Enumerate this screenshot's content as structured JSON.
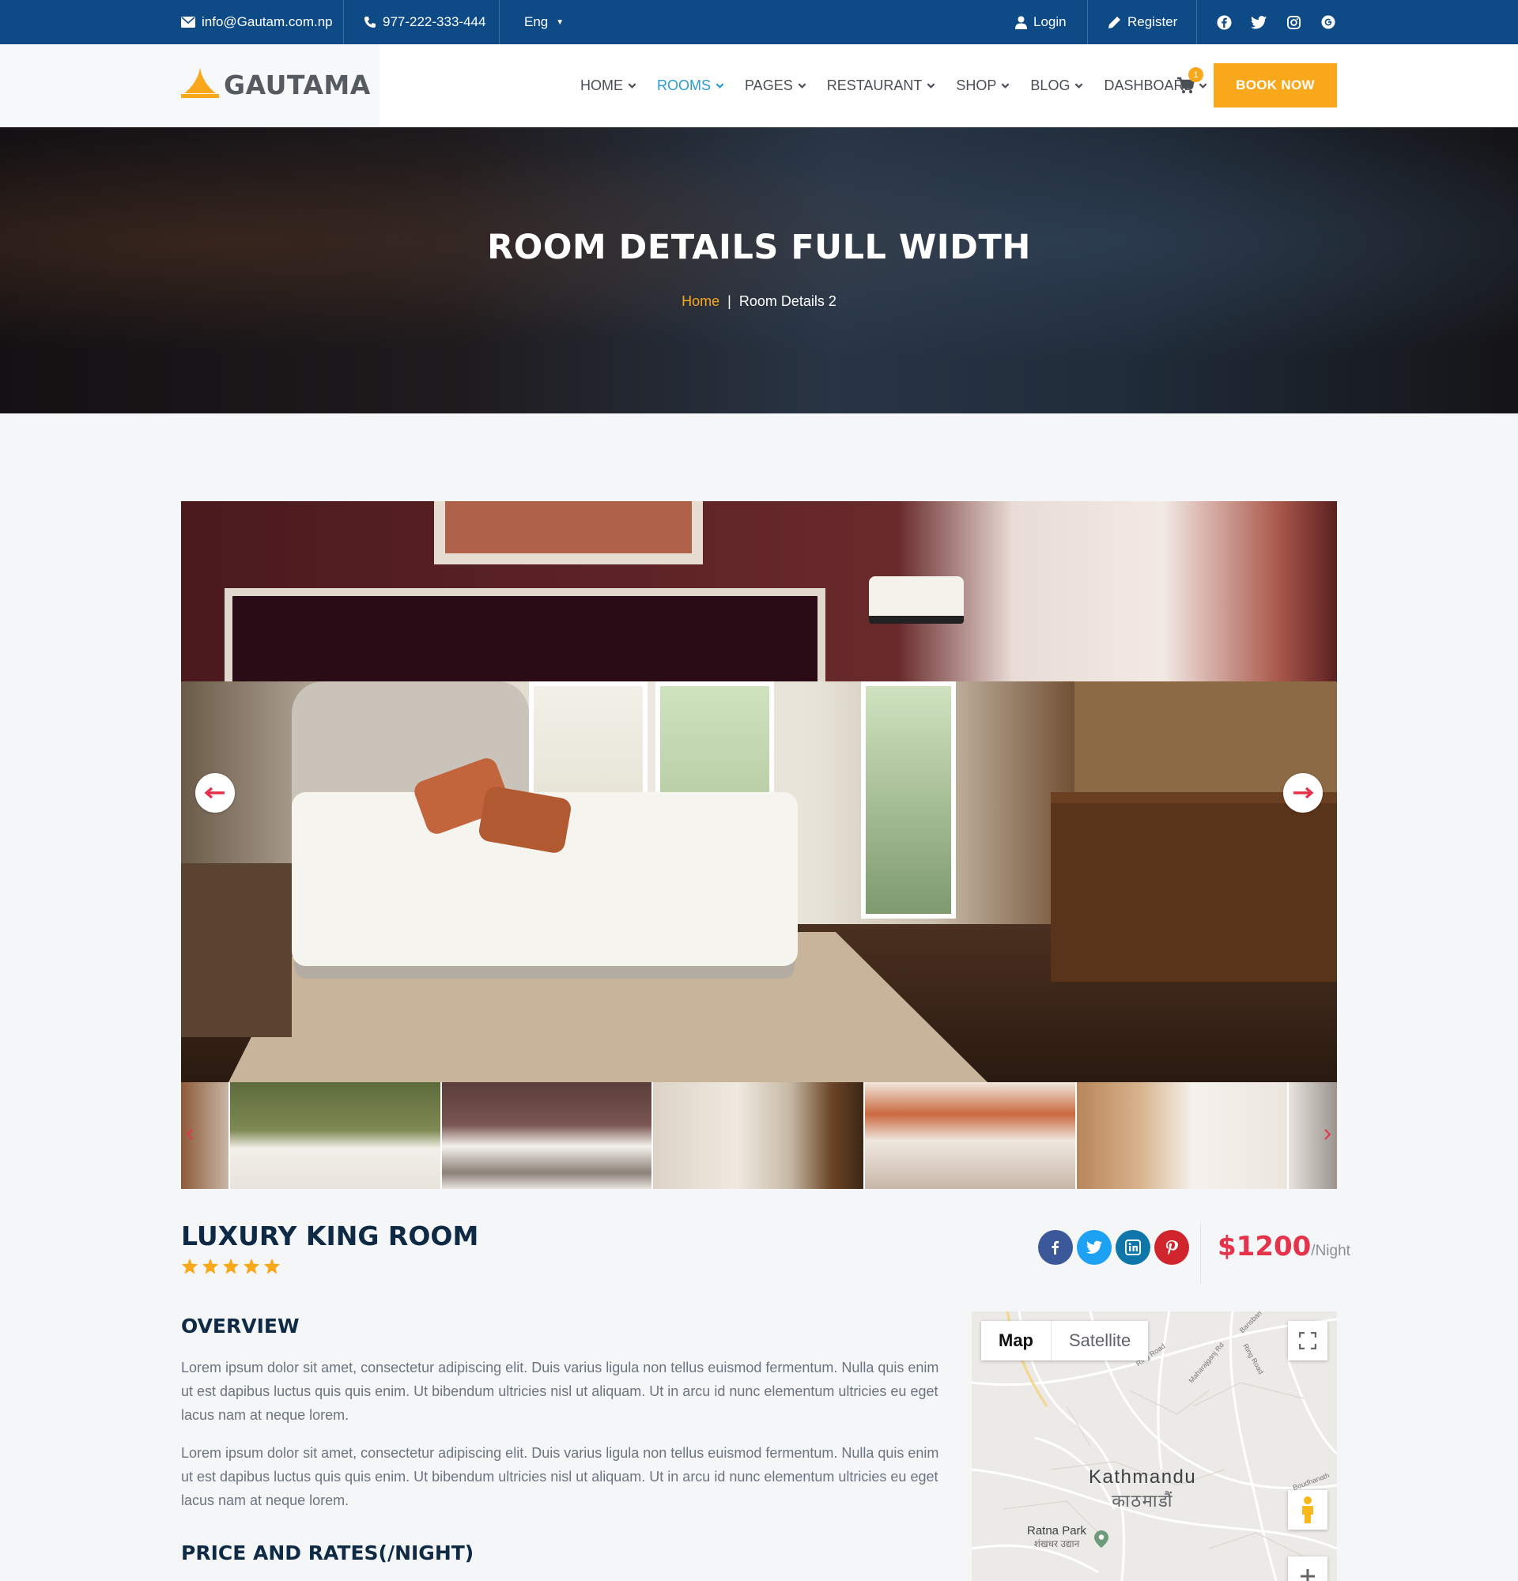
{
  "topbar": {
    "email": "info@Gautam.com.np",
    "phone": "977-222-333-444",
    "language": "Eng",
    "login": "Login",
    "register": "Register",
    "social_icons": [
      "facebook-icon",
      "twitter-icon",
      "instagram-icon",
      "google-icon"
    ]
  },
  "brand": {
    "name": "GAUTAMA"
  },
  "nav": {
    "items": [
      "HOME",
      "ROOMS",
      "PAGES",
      "RESTAURANT",
      "SHOP",
      "BLOG",
      "DASHBOARD"
    ],
    "active": "ROOMS",
    "cart_count": "1",
    "book_now": "BOOK NOW"
  },
  "hero": {
    "title": "ROOM DETAILS FULL WIDTH",
    "breadcrumb_home": "Home",
    "breadcrumb_separator": "|",
    "breadcrumb_current": "Room Details 2"
  },
  "room": {
    "title": "LUXURY KING ROOM",
    "rating": 5,
    "price": "$1200",
    "price_unit": "/Night",
    "share_icons": [
      "facebook-icon",
      "twitter-icon",
      "linkedin-icon",
      "pinterest-icon"
    ]
  },
  "overview": {
    "heading": "OVERVIEW",
    "paragraphs": [
      "Lorem ipsum dolor sit amet, consectetur adipiscing elit. Duis varius ligula non tellus euismod fermentum. Nulla quis enim ut est dapibus luctus quis quis enim. Ut bibendum ultricies nisl ut aliquam. Ut in arcu id nunc elementum ultricies eu eget lacus nam at neque lorem.",
      "Lorem ipsum dolor sit amet, consectetur adipiscing elit. Duis varius ligula non tellus euismod fermentum. Nulla quis enim ut est dapibus luctus quis quis enim. Ut bibendum ultricies nisl ut aliquam. Ut in arcu id nunc elementum ultricies eu eget lacus nam at neque lorem."
    ]
  },
  "price_rates": {
    "heading": "PRICE AND RATES(/NIGHT)"
  },
  "map": {
    "tab_map": "Map",
    "tab_satellite": "Satellite",
    "city": "Kathmandu",
    "city_local": "काठमाडौं",
    "place": "Ratna Park",
    "place_local": "शंखधर उद्यान",
    "roads": [
      "Ring Road",
      "Maharajganj Rd",
      "Ring Road",
      "Bansbari",
      "Boudhanath"
    ]
  },
  "colors": {
    "topbar": "#0d4a86",
    "accent": "#f9a81b",
    "nav_active": "#2a9bd6",
    "price": "#e5334b",
    "heading": "#0f2a44"
  }
}
